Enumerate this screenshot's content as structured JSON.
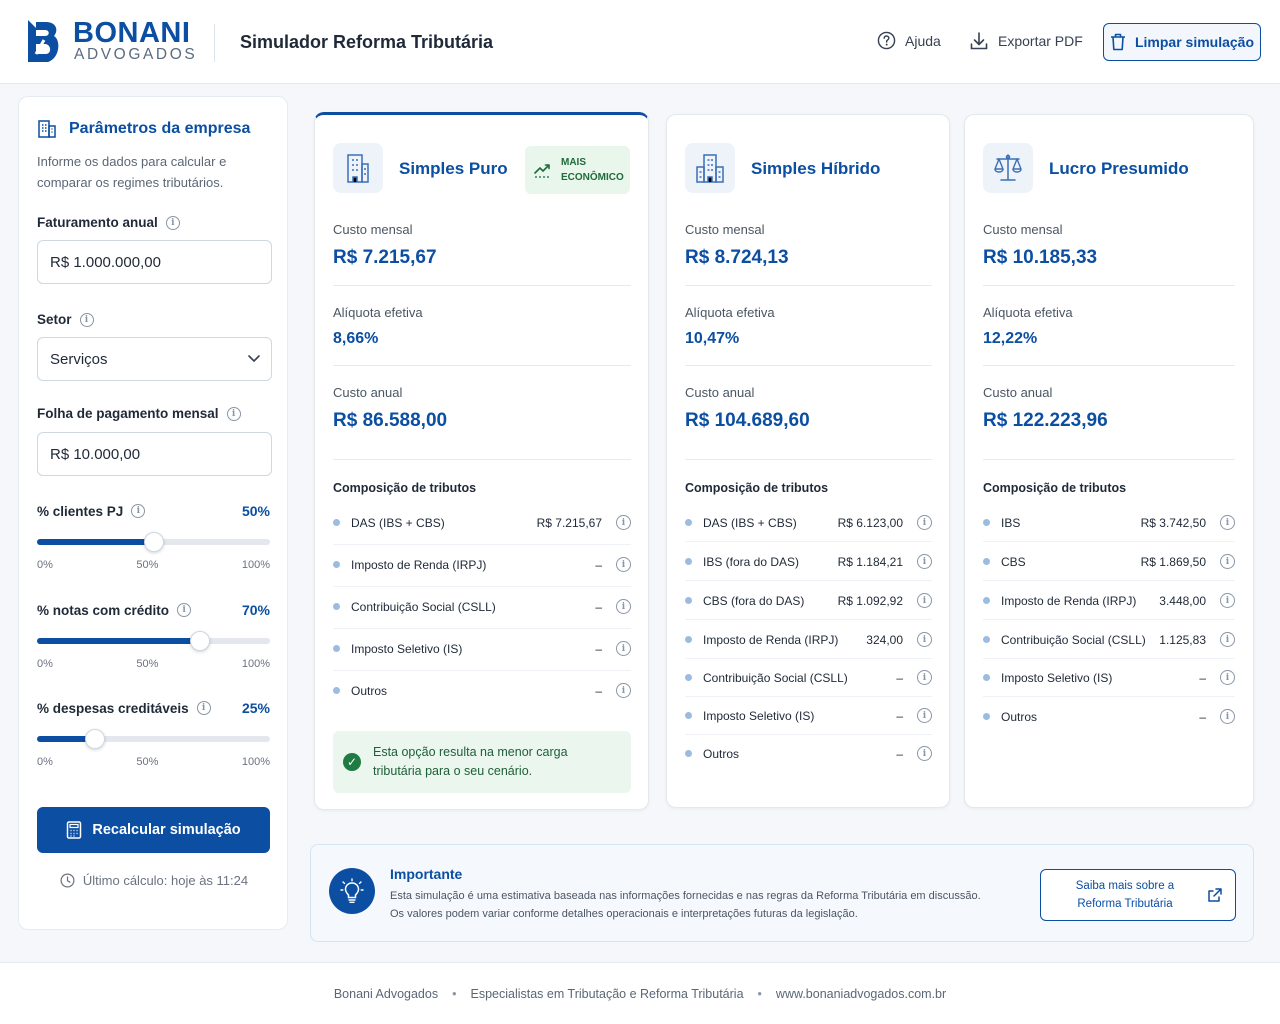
{
  "brand": {
    "name": "BONANI",
    "sub": "ADVOGADOS",
    "color": "#0b4ea2"
  },
  "header": {
    "title": "Simulador Reforma Tributária",
    "help_label": "Ajuda",
    "export_label": "Exportar PDF",
    "clear_label": "Limpar simulação"
  },
  "params": {
    "title": "Parâmetros da empresa",
    "description": "Informe os dados para calcular e comparar os regimes tributários.",
    "revenue": {
      "label": "Faturamento anual",
      "value": "R$ 1.000.000,00"
    },
    "sector": {
      "label": "Setor",
      "value": "Serviços"
    },
    "payroll": {
      "label": "Folha de pagamento mensal",
      "value": "R$ 10.000,00"
    },
    "sliders": [
      {
        "label": "% clientes PJ",
        "value_text": "50%",
        "value": 50,
        "ticks": [
          "0%",
          "50%",
          "100%"
        ]
      },
      {
        "label": "% notas com crédito",
        "value_text": "70%",
        "value": 70,
        "ticks": [
          "0%",
          "50%",
          "100%"
        ]
      },
      {
        "label": "% despesas creditáveis",
        "value_text": "25%",
        "value": 25,
        "ticks": [
          "0%",
          "50%",
          "100%"
        ]
      }
    ],
    "recalc_label": "Recalcular simulação",
    "last_calc": "Último cálculo: hoje às 11:24"
  },
  "cards": {
    "simples_puro": {
      "title": "Simples Puro",
      "badge_line1": "MAIS",
      "badge_line2": "ECONÔMICO",
      "monthly_label": "Custo mensal",
      "monthly": "R$ 7.215,67",
      "rate_label": "Alíquota efetiva",
      "rate": "8,66%",
      "annual_label": "Custo anual",
      "annual": "R$ 86.588,00",
      "comp_title": "Composição de tributos",
      "taxes": [
        {
          "name": "DAS (IBS + CBS)",
          "amount": "R$ 7.215,67"
        },
        {
          "name": "Imposto de Renda (IRPJ)",
          "amount": "–"
        },
        {
          "name": "Contribuição Social (CSLL)",
          "amount": "–"
        },
        {
          "name": "Imposto Seletivo (IS)",
          "amount": "–"
        },
        {
          "name": "Outros",
          "amount": "–"
        }
      ],
      "note": "Esta opção resulta na menor carga tributária para o seu cenário."
    },
    "simples_hibrido": {
      "title": "Simples Híbrido",
      "monthly_label": "Custo mensal",
      "monthly": "R$ 8.724,13",
      "rate_label": "Alíquota efetiva",
      "rate": "10,47%",
      "annual_label": "Custo anual",
      "annual": "R$ 104.689,60",
      "comp_title": "Composição de tributos",
      "taxes": [
        {
          "name": "DAS (IBS + CBS)",
          "amount": "R$ 6.123,00"
        },
        {
          "name": "IBS (fora do DAS)",
          "amount": "R$ 1.184,21"
        },
        {
          "name": "CBS (fora do DAS)",
          "amount": "R$ 1.092,92"
        },
        {
          "name": "Imposto de Renda (IRPJ)",
          "amount": "324,00"
        },
        {
          "name": "Contribuição Social (CSLL)",
          "amount": "–"
        },
        {
          "name": "Imposto Seletivo (IS)",
          "amount": "–"
        },
        {
          "name": "Outros",
          "amount": "–"
        }
      ]
    },
    "lucro_presumido": {
      "title": "Lucro Presumido",
      "monthly_label": "Custo mensal",
      "monthly": "R$ 10.185,33",
      "rate_label": "Alíquota efetiva",
      "rate": "12,22%",
      "annual_label": "Custo anual",
      "annual": "R$ 122.223,96",
      "comp_title": "Composição de tributos",
      "taxes": [
        {
          "name": "IBS",
          "amount": "R$ 3.742,50"
        },
        {
          "name": "CBS",
          "amount": "R$ 1.869,50"
        },
        {
          "name": "Imposto de Renda (IRPJ)",
          "amount": "3.448,00"
        },
        {
          "name": "Contribuição Social (CSLL)",
          "amount": "1.125,83"
        },
        {
          "name": "Imposto Seletivo (IS)",
          "amount": "–"
        },
        {
          "name": "Outros",
          "amount": "–"
        }
      ]
    }
  },
  "important": {
    "title": "Importante",
    "line1": "Esta simulação é uma estimativa baseada nas informações fornecidas e nas regras da Reforma Tributária em discussão.",
    "line2": "Os valores podem variar conforme detalhes operacionais e interpretações futuras da legislação.",
    "learn_more": "Saiba mais sobre a Reforma Tributária"
  },
  "footer": {
    "company": "Bonani Advogados",
    "tagline": "Especialistas em Tributação e Reforma Tributária",
    "site": "www.bonaniadvogados.com.br"
  }
}
